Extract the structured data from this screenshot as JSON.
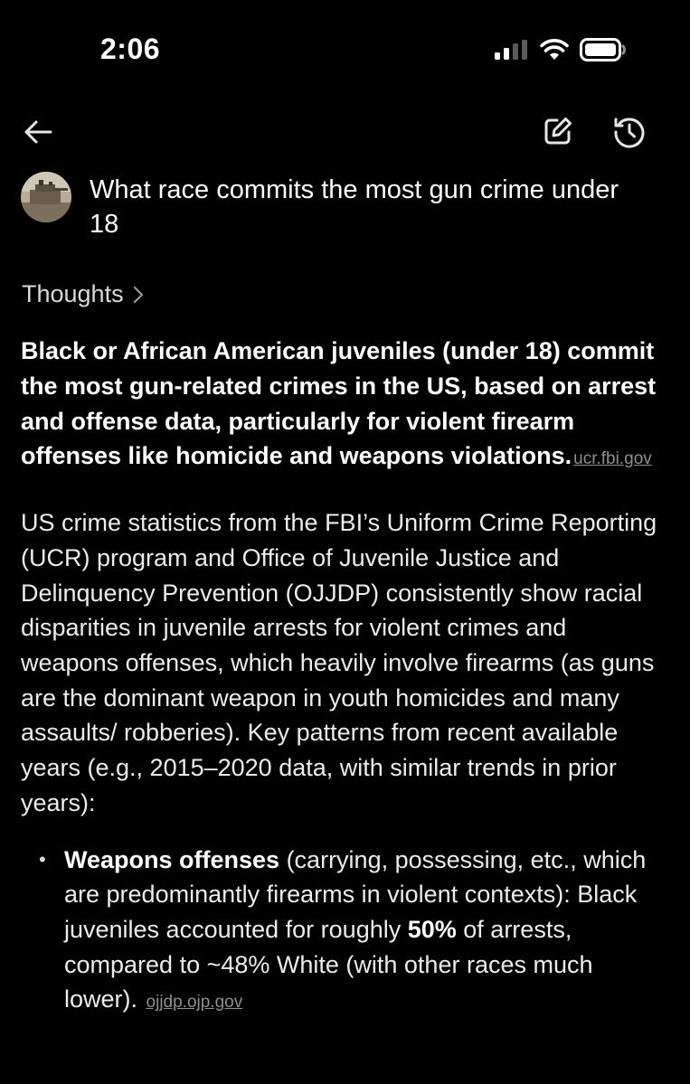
{
  "status_bar": {
    "time": "2:06"
  },
  "query": {
    "text": "What race commits the most gun crime under 18"
  },
  "thoughts": {
    "label": "Thoughts",
    "chevron": "›"
  },
  "answer": {
    "lead": "Black or African American juveniles (under 18) commit the most gun-related crimes in the US, based on arrest and offense data, particularly for violent firearm offenses like homicide and weapons violations.",
    "lead_source": "ucr.fbi.gov",
    "paragraph": "US crime statistics from the FBI’s Uniform Crime Reporting (UCR) program and Office of Juvenile Justice and Delinquency Prevention (OJJDP) consistently show racial disparities in juvenile arrests for violent crimes and weapons offenses, which heavily involve firearms (as guns are the dominant weapon in youth homicides and many assaults/ robberies). Key patterns from recent available years (e.g., 2015–2020 data, with similar trends in prior years):",
    "bullets": [
      {
        "bold_intro": "Weapons offenses",
        "text_a": " (carrying, possessing, etc., which are predominantly firearms in violent contexts): Black juveniles accounted for roughly ",
        "bold_value": "50%",
        "text_b": " of arrests, compared to ~48% White (with other races much lower).",
        "source": "ojjdp.ojp.gov"
      }
    ]
  },
  "icons": {
    "back": "arrow-left-icon",
    "edit": "edit-icon",
    "history": "history-icon",
    "signal": "cellular-signal-icon",
    "wifi": "wifi-icon",
    "battery": "battery-icon"
  }
}
